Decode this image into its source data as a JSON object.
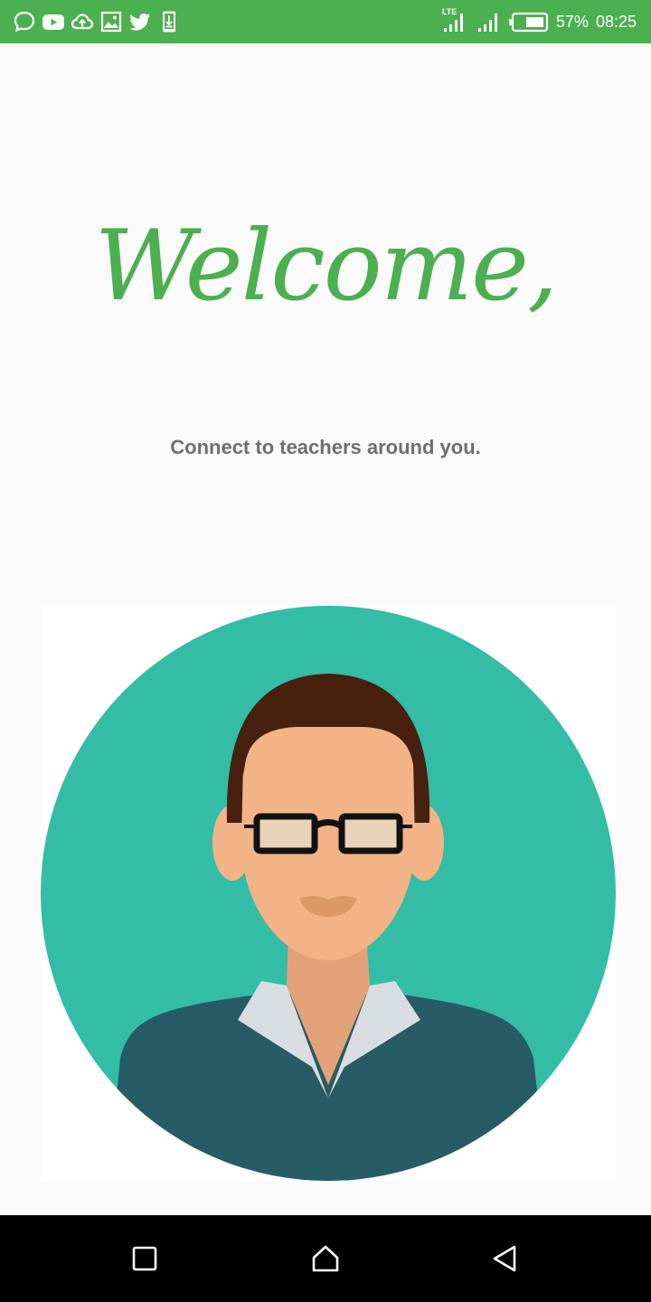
{
  "status_bar": {
    "background": "#4caf50",
    "notification_icons": [
      "chat-icon",
      "youtube-icon",
      "cloud-upload-icon",
      "image-icon",
      "twitter-icon",
      "download-icon"
    ],
    "network_label": "LTE",
    "battery_percent": "57%",
    "time": "08:25"
  },
  "welcome": {
    "title": "Welcome,",
    "subtitle": "Connect to teachers around you.",
    "accent_color": "#4caf50",
    "subtitle_color": "#6f6f6f"
  },
  "avatar": {
    "icon": "teacher-avatar",
    "circle_color": "#33bca6"
  },
  "nav_bar": {
    "icons": [
      "recent-apps-icon",
      "home-icon",
      "back-icon"
    ]
  }
}
